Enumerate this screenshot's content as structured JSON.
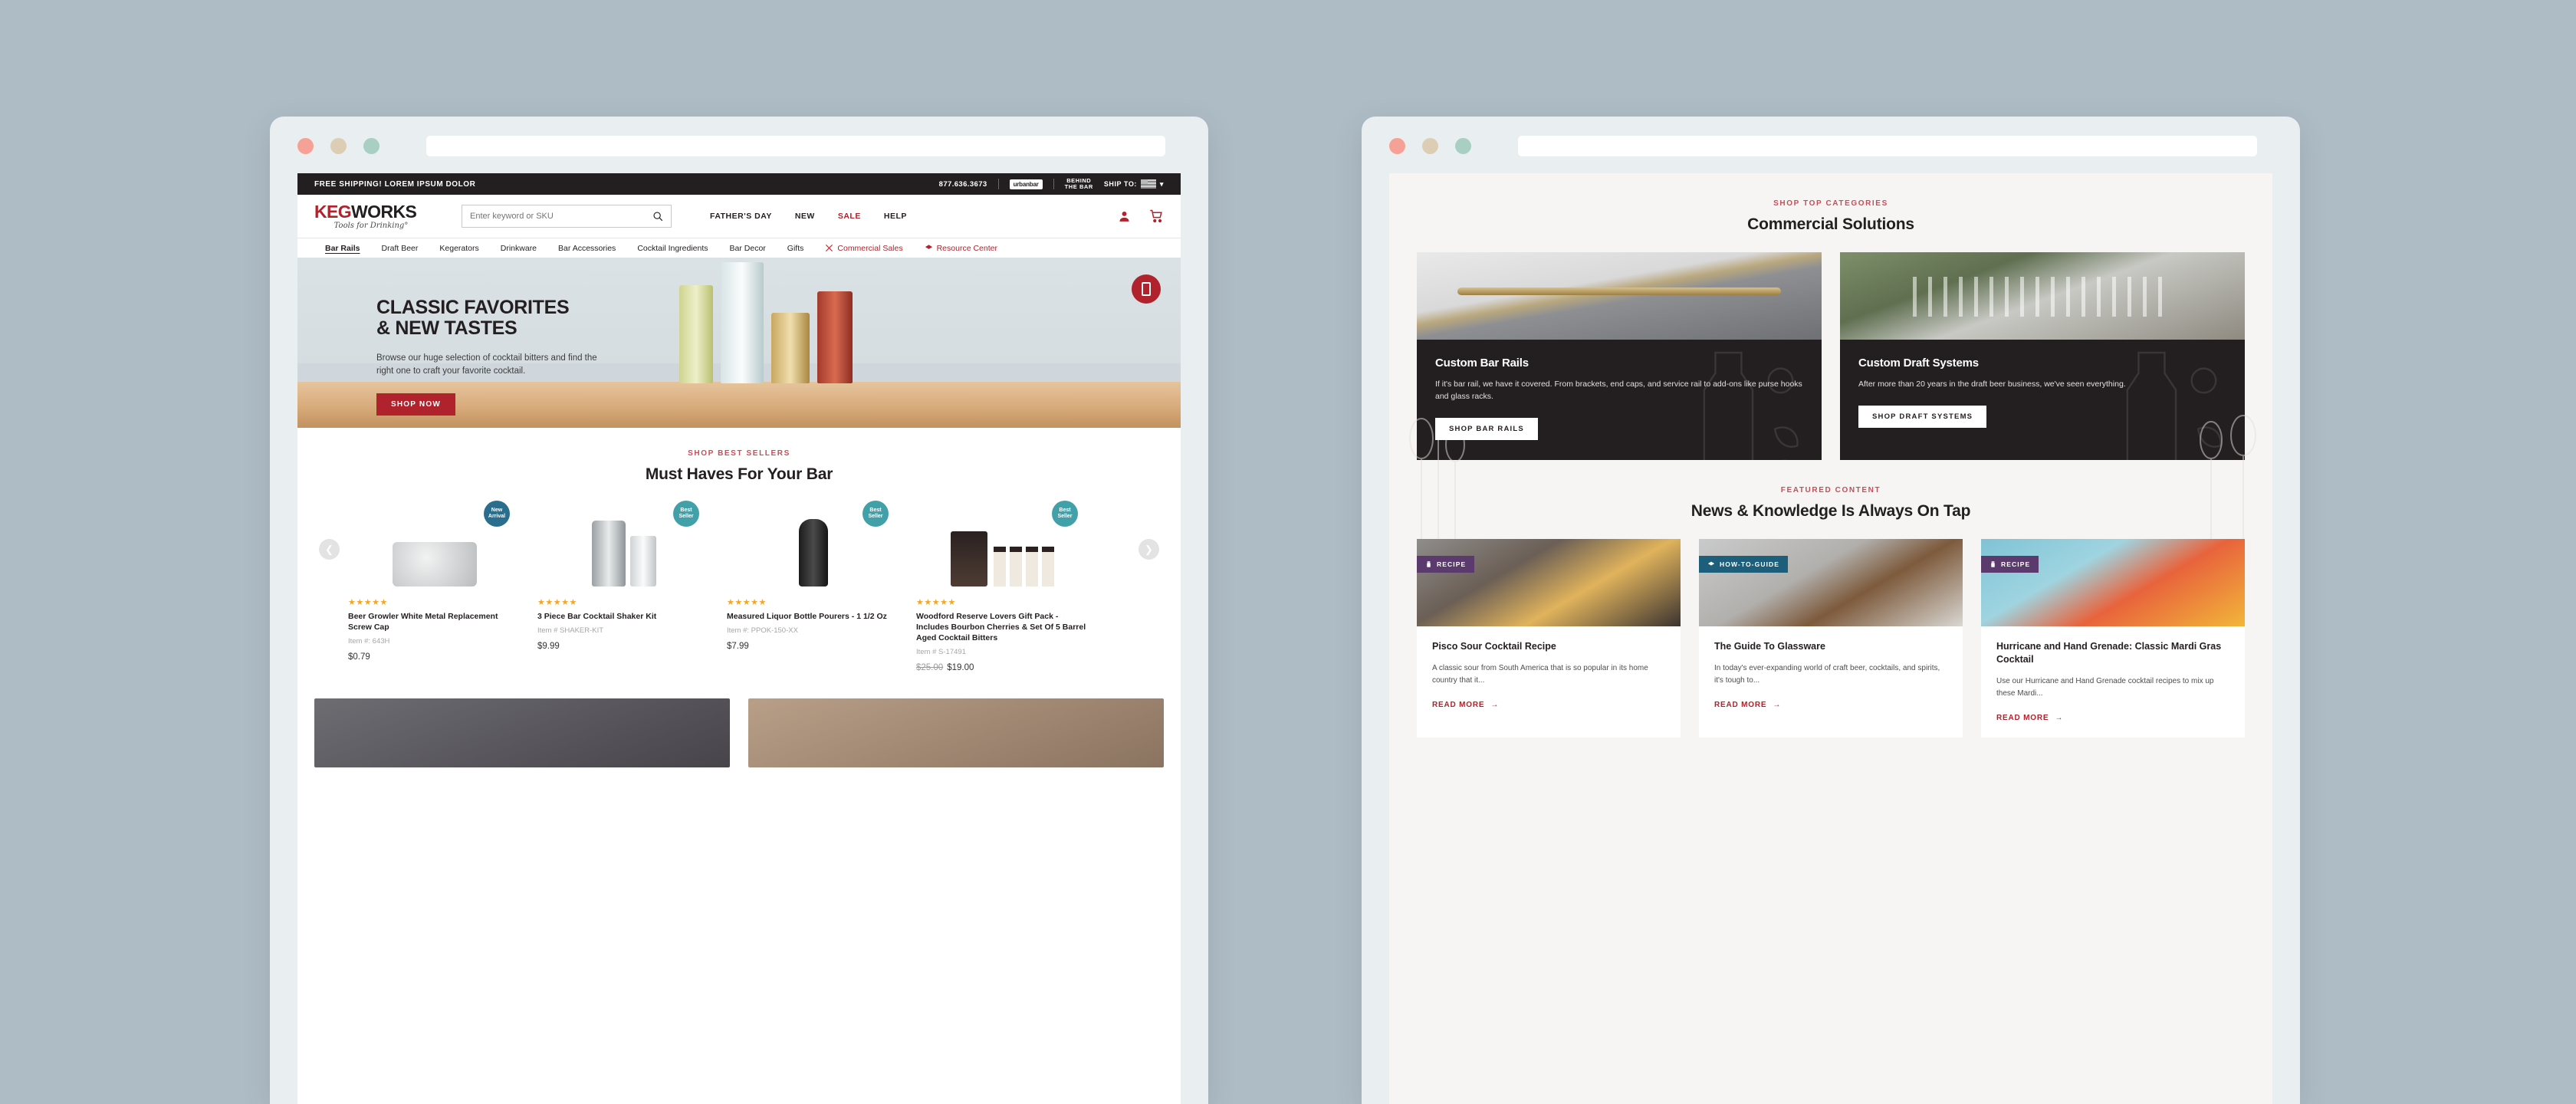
{
  "page": {
    "background_color": "#aebcc6",
    "accent_red": "#b0222c",
    "eyebrow_red": "#c2505b"
  },
  "windows": {
    "left": {
      "title": "",
      "url_value": ""
    },
    "right": {
      "title": "",
      "url_value": ""
    },
    "traffic_lights": [
      "close-red",
      "minimize-yellow",
      "maximize-green"
    ]
  },
  "site": {
    "topbar": {
      "promo": "FREE SHIPPING! LOREM IPSUM DOLOR",
      "phone": "877.636.3673",
      "brand_urbanbar": "urbanbar",
      "brand_behindthebar_line1": "BEHIND",
      "brand_behindthebar_line2": "THE BAR",
      "ship_to_label": "SHIP TO:",
      "ship_to_flag": "us-flag-icon",
      "caret": "⌄"
    },
    "header": {
      "logo_keg": "KEG",
      "logo_works": "WORKS",
      "tagline": "Tools for Drinking°",
      "search_placeholder": "Enter keyword or SKU",
      "search_value": "",
      "links": [
        {
          "label": "FATHER'S DAY",
          "accent": false
        },
        {
          "label": "NEW",
          "accent": false
        },
        {
          "label": "SALE",
          "accent": true
        },
        {
          "label": "HELP",
          "accent": false
        }
      ],
      "icons": [
        "account-icon",
        "cart-icon"
      ]
    },
    "nav": [
      {
        "label": "Bar Rails",
        "active": true,
        "accent": false,
        "icon": ""
      },
      {
        "label": "Draft Beer",
        "active": false,
        "accent": false,
        "icon": ""
      },
      {
        "label": "Kegerators",
        "active": false,
        "accent": false,
        "icon": ""
      },
      {
        "label": "Drinkware",
        "active": false,
        "accent": false,
        "icon": ""
      },
      {
        "label": "Bar Accessories",
        "active": false,
        "accent": false,
        "icon": ""
      },
      {
        "label": "Cocktail Ingredients",
        "active": false,
        "accent": false,
        "icon": ""
      },
      {
        "label": "Bar Decor",
        "active": false,
        "accent": false,
        "icon": ""
      },
      {
        "label": "Gifts",
        "active": false,
        "accent": false,
        "icon": ""
      },
      {
        "label": "Commercial Sales",
        "active": false,
        "accent": true,
        "icon": "shaker-icon"
      },
      {
        "label": "Resource Center",
        "active": false,
        "accent": true,
        "icon": "book-icon"
      }
    ],
    "hero": {
      "title_line1": "CLASSIC FAVORITES",
      "title_line2": "& NEW TASTES",
      "body": "Browse our huge selection of cocktail bitters and find the right one to craft your favorite cocktail.",
      "cta": "SHOP NOW",
      "floating_button_icon": "mobile-phone-icon"
    },
    "best_sellers": {
      "eyebrow": "SHOP BEST SELLERS",
      "title": "Must Haves For Your Bar",
      "prev_icon": "chevron-left-icon",
      "next_icon": "chevron-right-icon",
      "products": [
        {
          "badge": "New Arrival",
          "badge_type": "new",
          "stars": "★★★★★",
          "name": "Beer Growler White Metal Replacement Screw Cap",
          "sku": "Item #: 643H",
          "price": "$0.79",
          "was_price": ""
        },
        {
          "badge": "Best Seller",
          "badge_type": "best",
          "stars": "★★★★★",
          "name": "3 Piece Bar Cocktail Shaker Kit",
          "sku": "Item # SHAKER-KIT",
          "price": "$9.99",
          "was_price": ""
        },
        {
          "badge": "Best Seller",
          "badge_type": "best",
          "stars": "★★★★★",
          "name": "Measured Liquor Bottle Pourers - 1 1/2 Oz",
          "sku": "Item #: PPOK-150-XX",
          "price": "$7.99",
          "was_price": ""
        },
        {
          "badge": "Best Seller",
          "badge_type": "best",
          "stars": "★★★★★",
          "name": "Woodford Reserve Lovers Gift Pack - Includes Bourbon Cherries & Set Of 5 Barrel Aged Cocktail Bitters",
          "sku": "Item # S-17491",
          "price": "$19.00",
          "was_price": "$25.00"
        }
      ]
    },
    "commercial": {
      "eyebrow": "SHOP TOP CATEGORIES",
      "title": "Commercial Solutions",
      "cards": [
        {
          "image": "brass-bar-rail-photo",
          "title": "Custom Bar Rails",
          "body": "If it's bar rail, we have it covered. From brackets, end caps, and service rail to add-ons like purse hooks and glass racks.",
          "cta": "SHOP BAR RAILS"
        },
        {
          "image": "draft-beer-taps-photo",
          "title": "Custom Draft Systems",
          "body": "After more than 20 years in the draft beer business, we've seen everything.",
          "cta": "SHOP DRAFT SYSTEMS"
        }
      ]
    },
    "featured": {
      "eyebrow": "FEATURED CONTENT",
      "title": "News & Knowledge Is Always On Tap",
      "read_more_label": "READ MORE",
      "read_more_icon": "arrow-right-icon",
      "articles": [
        {
          "tag": "RECIPE",
          "tag_type": "recipe",
          "tag_icon": "shaker-icon",
          "image": "pisco-sour-photo",
          "title": "Pisco Sour Cocktail Recipe",
          "excerpt": "A classic sour from South America that is so popular in its home country that it..."
        },
        {
          "tag": "HOW-TO-GUIDE",
          "tag_type": "howto",
          "tag_icon": "book-icon",
          "image": "glassware-photo",
          "title": "The Guide To Glassware",
          "excerpt": "In today's ever-expanding world of craft beer, cocktails, and spirits, it's tough to..."
        },
        {
          "tag": "RECIPE",
          "tag_type": "recipe",
          "tag_icon": "shaker-icon",
          "image": "hurricane-cocktail-photo",
          "title": "Hurricane and Hand Grenade: Classic Mardi Gras Cocktail",
          "excerpt": "Use our Hurricane and Hand Grenade cocktail recipes to mix up these Mardi..."
        }
      ]
    }
  }
}
